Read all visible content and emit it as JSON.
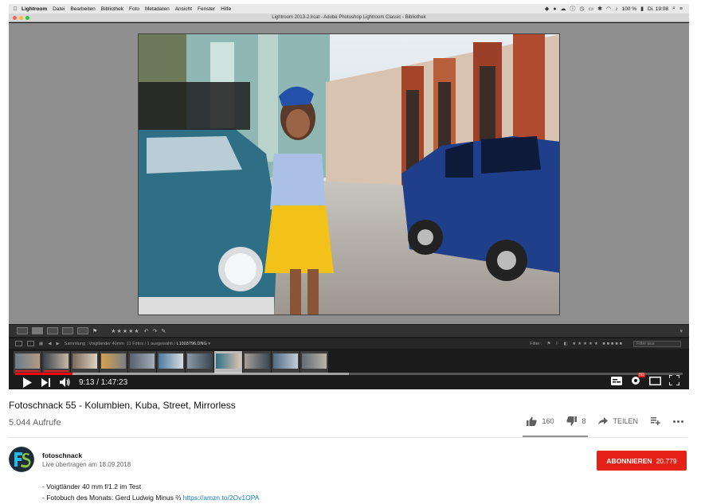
{
  "menubar": {
    "app": "Lightroom",
    "items": [
      "Datei",
      "Bearbeiten",
      "Bibliothek",
      "Foto",
      "Metadaten",
      "Ansicht",
      "Fenster",
      "Hilfe"
    ],
    "battery": "100 %",
    "clock": "Di. 19:08"
  },
  "window": {
    "title": "Lightroom 2013-2.lrcat - Adobe Photoshop Lightroom Classic - Bibliothek"
  },
  "lr_toolbar": {
    "stars": "★★★★★"
  },
  "filmstrip": {
    "collection": "Sammlung : Voigtländer 40mm",
    "count": "11 Fotos / 1 ausgewählt /",
    "file": "L1003796.DNG",
    "filter_label": "Filter :",
    "filter_value": "Filter aus",
    "selected_index": 7
  },
  "player": {
    "current_time": "9:13",
    "duration": "1:47:23",
    "time_display": "9:13 / 1:47:23",
    "progress": 0.086,
    "buffered": 0.5
  },
  "video": {
    "title": "Fotoschnack 55 - Kolumbien, Kuba, Street, Mirrorless",
    "views": "5.044 Aufrufe",
    "likes": "160",
    "dislikes": "8",
    "share_label": "TEILEN"
  },
  "channel": {
    "name": "fotoschnack",
    "published": "Live übertragen am 18.09.2018",
    "subscribe_label": "ABONNIEREN",
    "subscribers": "20.779"
  },
  "description": {
    "line1": "- Voigtländer 40 mm f/1.2 im Test",
    "line2_text": "- Fotobuch des Monats: Gerd Ludwig Minus ⅔",
    "line2_link": "https://amzn.to/2Ov1OPA"
  },
  "colors": {
    "youtube_red": "#e62117",
    "link_blue": "#167ac6",
    "progress_red": "#ff0000"
  }
}
